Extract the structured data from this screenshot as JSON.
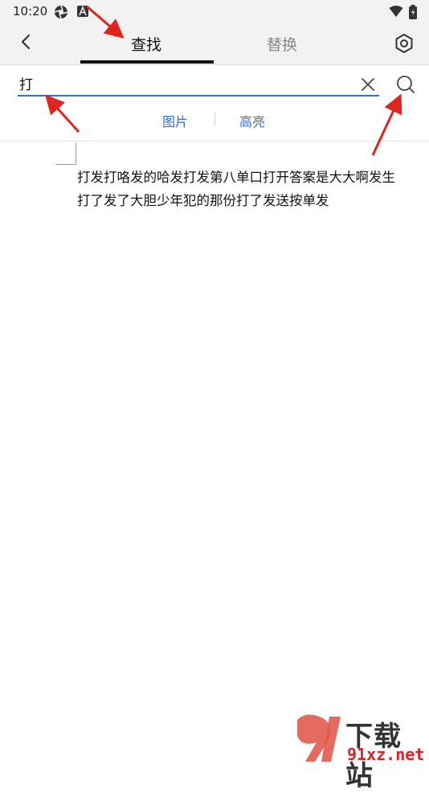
{
  "status_bar": {
    "time": "10:20",
    "left_icons": [
      "aperture-icon",
      "a-badge-icon"
    ],
    "right_icons": [
      "wifi-icon",
      "battery-icon"
    ]
  },
  "header": {
    "back_icon": "chevron-left-icon",
    "tabs": [
      {
        "label": "查找",
        "active": true
      },
      {
        "label": "替换",
        "active": false
      }
    ],
    "settings_icon": "gear-icon"
  },
  "search": {
    "value": "打",
    "clear_icon": "close-icon",
    "search_icon": "search-icon"
  },
  "filters": [
    {
      "label": "图片"
    },
    {
      "label": "高亮"
    }
  ],
  "document": {
    "lines": [
      "打发打咯发的哈发打发第八单口打开答案是大大啊发生",
      "打了发了大胆少年犯的那份打了发送按单发"
    ]
  },
  "watermark": {
    "text": "下载站",
    "url": "91xz.net"
  },
  "colors": {
    "accent": "#2f6fe0",
    "annotation": "#e0241e",
    "header_bg": "#f2f2f2"
  }
}
